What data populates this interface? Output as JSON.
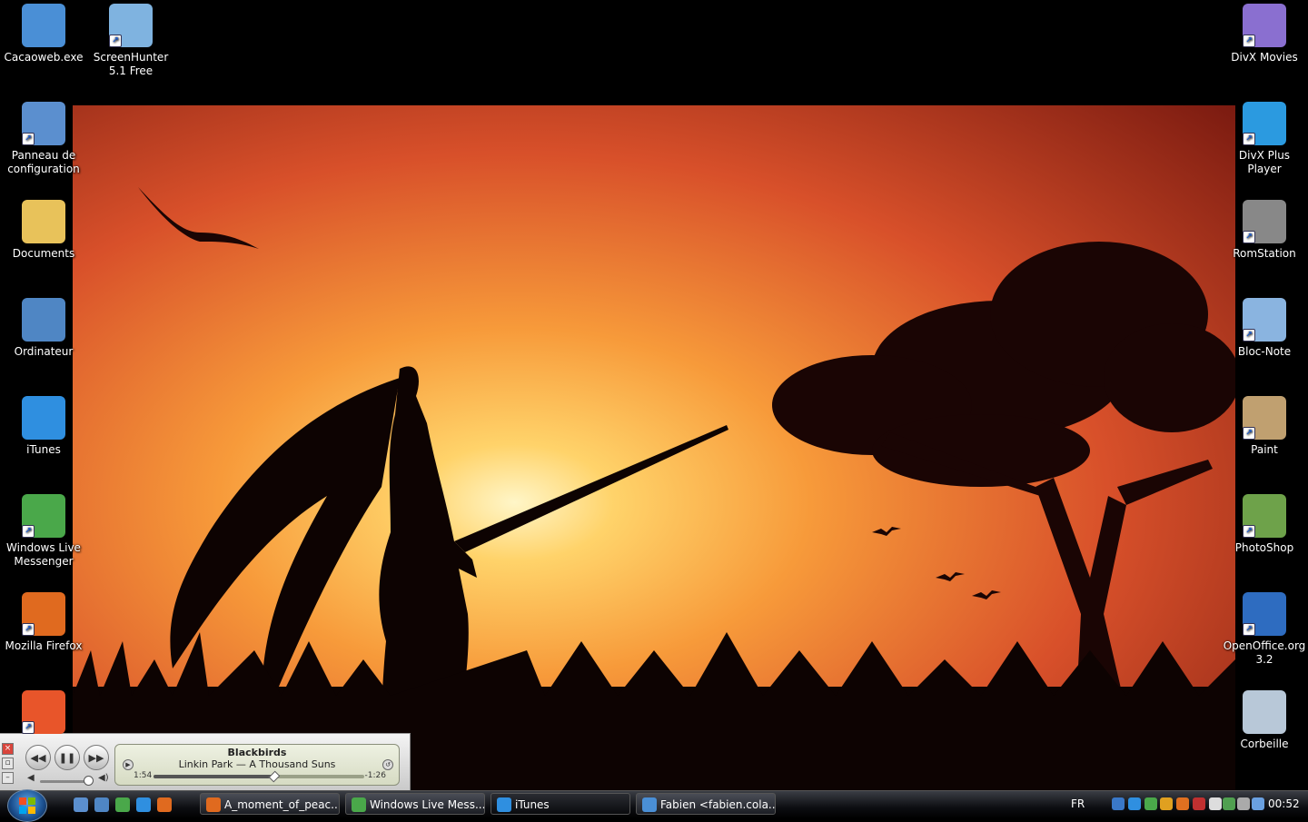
{
  "desktop_icons_left": [
    {
      "label": "Cacaoweb.exe",
      "icon": "cacaoweb-icon",
      "color": "#4a8fd6",
      "shortcut": false
    },
    {
      "label": "ScreenHunter 5.1 Free",
      "icon": "hand-icon",
      "color": "#7fb3e0",
      "shortcut": true
    },
    {
      "label": "Panneau de configuration",
      "icon": "control-panel-icon",
      "color": "#5b8fcf",
      "shortcut": true
    },
    {
      "label": "Documents",
      "icon": "folder-icon",
      "color": "#e8c25a",
      "shortcut": false
    },
    {
      "label": "Ordinateur",
      "icon": "computer-icon",
      "color": "#4f86c4",
      "shortcut": false
    },
    {
      "label": "iTunes",
      "icon": "itunes-icon",
      "color": "#2f8fe0",
      "shortcut": false
    },
    {
      "label": "Windows Live Messenger",
      "icon": "messenger-icon",
      "color": "#4aa84a",
      "shortcut": true
    },
    {
      "label": "Mozilla Firefox",
      "icon": "firefox-icon",
      "color": "#e06a1f",
      "shortcut": true
    },
    {
      "label": "",
      "icon": "k-app-icon",
      "color": "#e8552a",
      "shortcut": true
    }
  ],
  "desktop_icons_right": [
    {
      "label": "DivX Movies",
      "icon": "divx-movies-icon",
      "color": "#8a6fd0",
      "shortcut": true
    },
    {
      "label": "DivX Plus Player",
      "icon": "play-icon",
      "color": "#2b9ae0",
      "shortcut": true
    },
    {
      "label": "RomStation",
      "icon": "romstation-icon",
      "color": "#888888",
      "shortcut": true
    },
    {
      "label": "Bloc-Note",
      "icon": "notepad-icon",
      "color": "#8ab4e0",
      "shortcut": true
    },
    {
      "label": "Paint",
      "icon": "paint-icon",
      "color": "#c0a070",
      "shortcut": true
    },
    {
      "label": "PhotoShop",
      "icon": "photoshop-icon",
      "color": "#6ea24a",
      "shortcut": true
    },
    {
      "label": "OpenOffice.org 3.2",
      "icon": "openoffice-icon",
      "color": "#2e6cc0",
      "shortcut": true
    },
    {
      "label": "Corbeille",
      "icon": "recycle-bin-icon",
      "color": "#b8c8d8",
      "shortcut": false
    }
  ],
  "mini_player": {
    "song": "Blackbirds",
    "artist_album": "Linkin Park — A Thousand Suns",
    "elapsed": "1:54",
    "remaining": "-1:26",
    "progress": 0.57,
    "volume": 0.9
  },
  "taskbar": {
    "quick_launch": [
      {
        "icon": "show-desktop-icon",
        "color": "#5b8fcf"
      },
      {
        "icon": "switch-windows-icon",
        "color": "#4f86c4"
      },
      {
        "icon": "messenger-icon",
        "color": "#4aa84a"
      },
      {
        "icon": "itunes-icon",
        "color": "#2f8fe0"
      },
      {
        "icon": "firefox-icon",
        "color": "#e06a1f"
      }
    ],
    "buttons": [
      {
        "label": "A_moment_of_peac...",
        "icon": "firefox-icon",
        "color": "#e06a1f",
        "active": false
      },
      {
        "label": "Windows Live Mess...",
        "icon": "messenger-icon",
        "color": "#4aa84a",
        "active": false
      },
      {
        "label": "iTunes",
        "icon": "itunes-icon",
        "color": "#2f8fe0",
        "active": true
      },
      {
        "label": "Fabien <fabien.cola...",
        "icon": "messenger-chat-icon",
        "color": "#4a8fd6",
        "active": false
      }
    ],
    "language": "FR",
    "tray": [
      {
        "icon": "network-app-icon",
        "color": "#3a78c8"
      },
      {
        "icon": "itunes-tray-icon",
        "color": "#2f8fe0"
      },
      {
        "icon": "messenger-tray-icon",
        "color": "#4aa84a"
      },
      {
        "icon": "update-icon",
        "color": "#e0a020"
      },
      {
        "icon": "vlc-icon",
        "color": "#e07020"
      },
      {
        "icon": "shield-icon",
        "color": "#c03030"
      },
      {
        "icon": "antivirus-icon",
        "color": "#dddddd"
      },
      {
        "icon": "download-icon",
        "color": "#50a050"
      },
      {
        "icon": "safely-remove-icon",
        "color": "#aaaaaa"
      },
      {
        "icon": "network-icon",
        "color": "#6aa0e0"
      },
      {
        "icon": "volume-icon",
        "color": "#dddddd"
      }
    ],
    "clock": "00:52"
  }
}
